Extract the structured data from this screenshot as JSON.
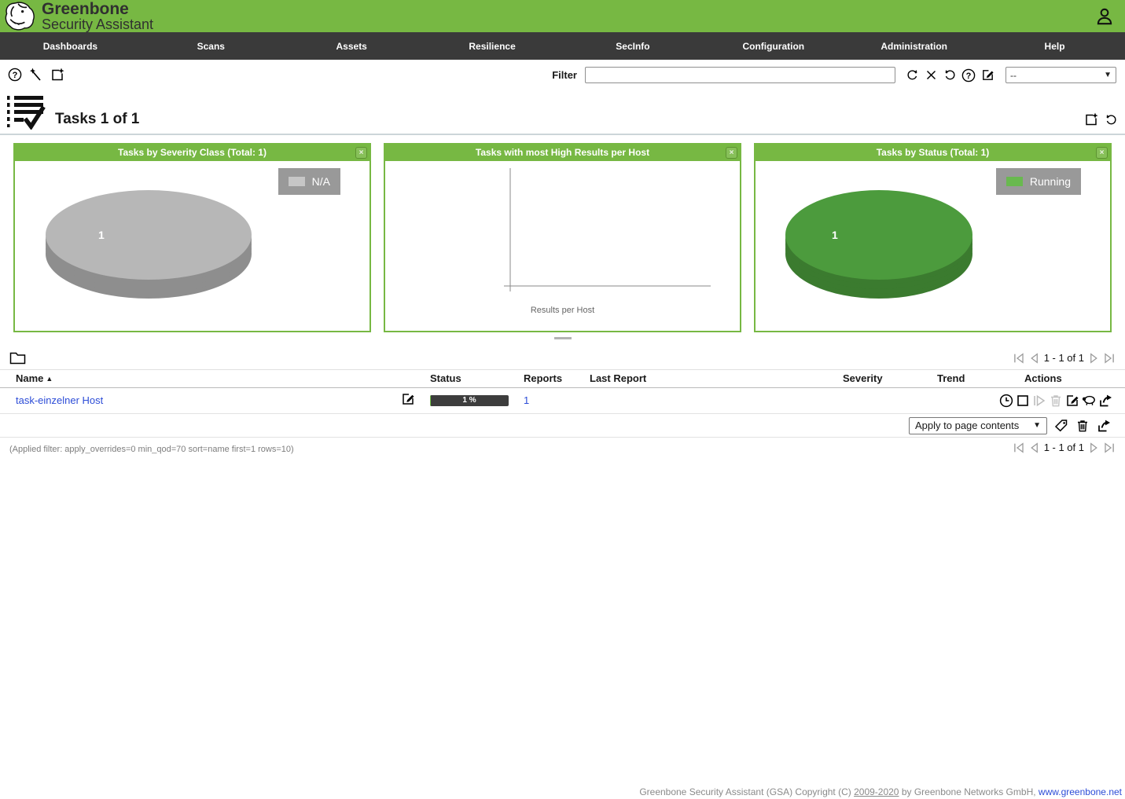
{
  "app": {
    "brand_line1": "Greenbone",
    "brand_line2": "Security Assistant"
  },
  "icons": {
    "close_glyph": "×",
    "dropdown_arrow": "▼",
    "sort_asc": "▲"
  },
  "colors": {
    "banner_green": "#77b843",
    "nav_dark": "#3a3a3a",
    "link_blue": "#2c4cd7",
    "legend_bg": "#999999",
    "status_bar_bg": "#3d3d3d",
    "status_progress_green": "#6fbf44"
  },
  "nav": {
    "items": [
      {
        "label": "Dashboards"
      },
      {
        "label": "Scans"
      },
      {
        "label": "Assets"
      },
      {
        "label": "Resilience"
      },
      {
        "label": "SecInfo"
      },
      {
        "label": "Configuration"
      },
      {
        "label": "Administration"
      },
      {
        "label": "Help"
      }
    ]
  },
  "toolbar": {
    "filter_label": "Filter",
    "filter_value": "",
    "powerfilter_select_value": "--"
  },
  "page": {
    "title": "Tasks 1 of 1"
  },
  "dashboard": {
    "panels": [
      {
        "title": "Tasks by Severity Class (Total: 1)",
        "slice_label": "1",
        "legend": [
          {
            "label": "N/A",
            "color": "#c6c6c6"
          }
        ],
        "colors": {
          "top": "#b7b7b7",
          "side": "#8e8e8e"
        }
      },
      {
        "title": "Tasks with most High Results per Host",
        "xlabel": "Results per Host"
      },
      {
        "title": "Tasks by Status (Total: 1)",
        "slice_label": "1",
        "legend": [
          {
            "label": "Running",
            "color": "#69b94f"
          }
        ],
        "colors": {
          "top": "#4c9b3d",
          "side": "#3b7b2f"
        }
      }
    ],
    "chart_data": [
      {
        "type": "pie",
        "title": "Tasks by Severity Class (Total: 1)",
        "labels": [
          "N/A"
        ],
        "values": [
          1
        ]
      },
      {
        "type": "bar",
        "title": "Tasks with most High Results per Host",
        "xlabel": "Results per Host",
        "categories": [],
        "values": []
      },
      {
        "type": "pie",
        "title": "Tasks by Status (Total: 1)",
        "labels": [
          "Running"
        ],
        "values": [
          1
        ]
      }
    ]
  },
  "table": {
    "columns": {
      "name": "Name",
      "status": "Status",
      "reports": "Reports",
      "last_report": "Last Report",
      "severity": "Severity",
      "trend": "Trend",
      "actions": "Actions"
    },
    "row": {
      "name": "task-einzelner Host",
      "status_percent_label": "1 %",
      "status_percent": 1,
      "reports": "1",
      "last_report": "",
      "severity": "",
      "trend": ""
    },
    "bulk_action_value": "Apply to page contents",
    "applied_filter": "(Applied filter: apply_overrides=0 min_qod=70 sort=name first=1 rows=10)",
    "pagination": {
      "label": "1 - 1 of 1"
    }
  },
  "footer": {
    "text": "Greenbone Security Assistant (GSA) Copyright (C)",
    "years": "2009-2020",
    "by": "by Greenbone Networks GmbH,",
    "link": "www.greenbone.net"
  }
}
